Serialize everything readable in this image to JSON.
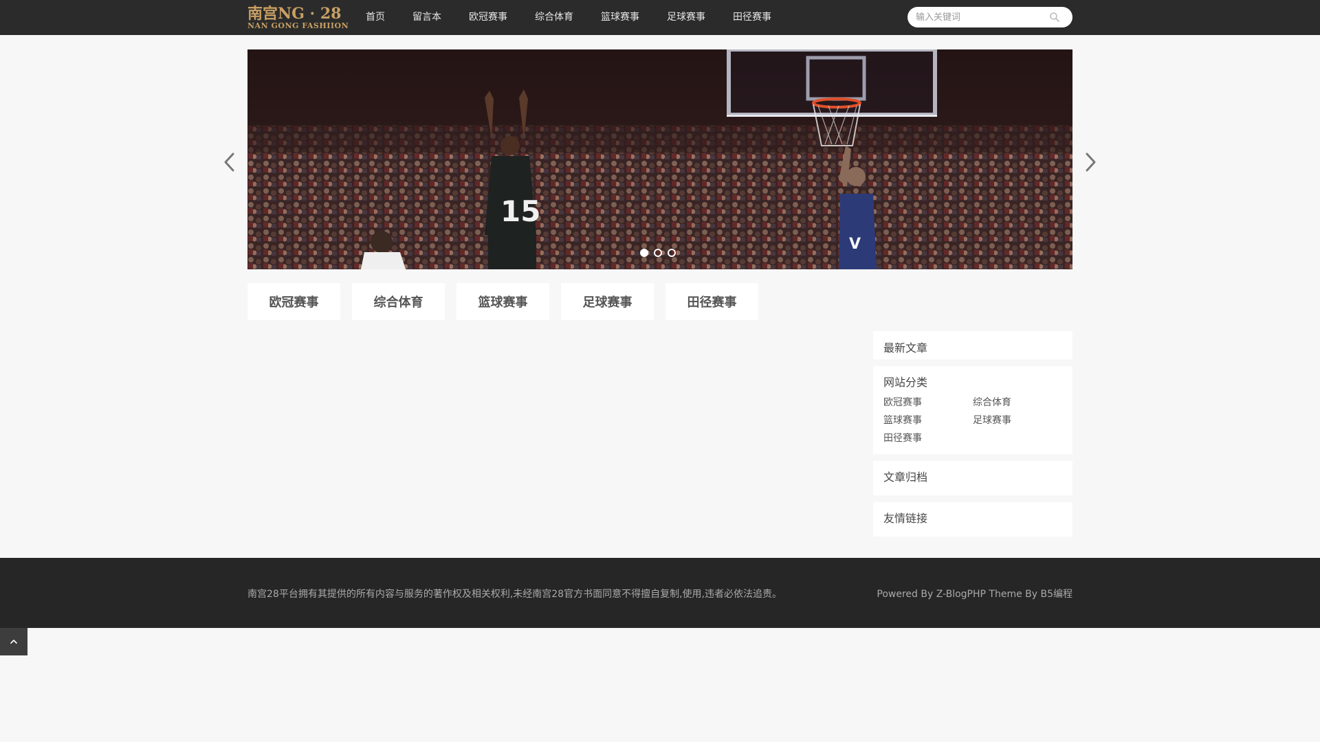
{
  "logo": {
    "line1": "南宫NG · 28",
    "line2": "NAN GONG FASHIION"
  },
  "nav": {
    "items": [
      {
        "label": "首页"
      },
      {
        "label": "留言本"
      },
      {
        "label": "欧冠赛事"
      },
      {
        "label": "综合体育"
      },
      {
        "label": "篮球赛事"
      },
      {
        "label": "足球赛事"
      },
      {
        "label": "田径赛事"
      }
    ]
  },
  "search": {
    "placeholder": "输入关键词",
    "icon": "search-icon"
  },
  "slider": {
    "slide_count": 3,
    "active_index": 0,
    "icons": {
      "prev": "chevron-left-icon",
      "next": "chevron-right-icon"
    }
  },
  "categories": [
    {
      "label": "欧冠赛事"
    },
    {
      "label": "综合体育"
    },
    {
      "label": "篮球赛事"
    },
    {
      "label": "足球赛事"
    },
    {
      "label": "田径赛事"
    }
  ],
  "sidebar": {
    "latest": {
      "title": "最新文章"
    },
    "site_categories": {
      "title": "网站分类",
      "items": [
        "欧冠赛事",
        "综合体育",
        "篮球赛事",
        "足球赛事",
        "田径赛事"
      ]
    },
    "archive": {
      "title": "文章归档"
    },
    "links": {
      "title": "友情链接"
    }
  },
  "footer": {
    "copyright": "南宫28平台拥有其提供的所有内容与服务的著作权及相关权利,未经南宫28官方书面同意不得擅自复制,使用,违者必依法追责。",
    "powered": "Powered By Z-BlogPHP Theme By B5编程"
  },
  "back_to_top": {
    "icon": "chevron-up-icon"
  },
  "colors": {
    "header_bg": "#2b2b2b",
    "page_bg": "#f7f7f7",
    "logo_gold": "#c9a064",
    "footer_bg": "#262626"
  }
}
